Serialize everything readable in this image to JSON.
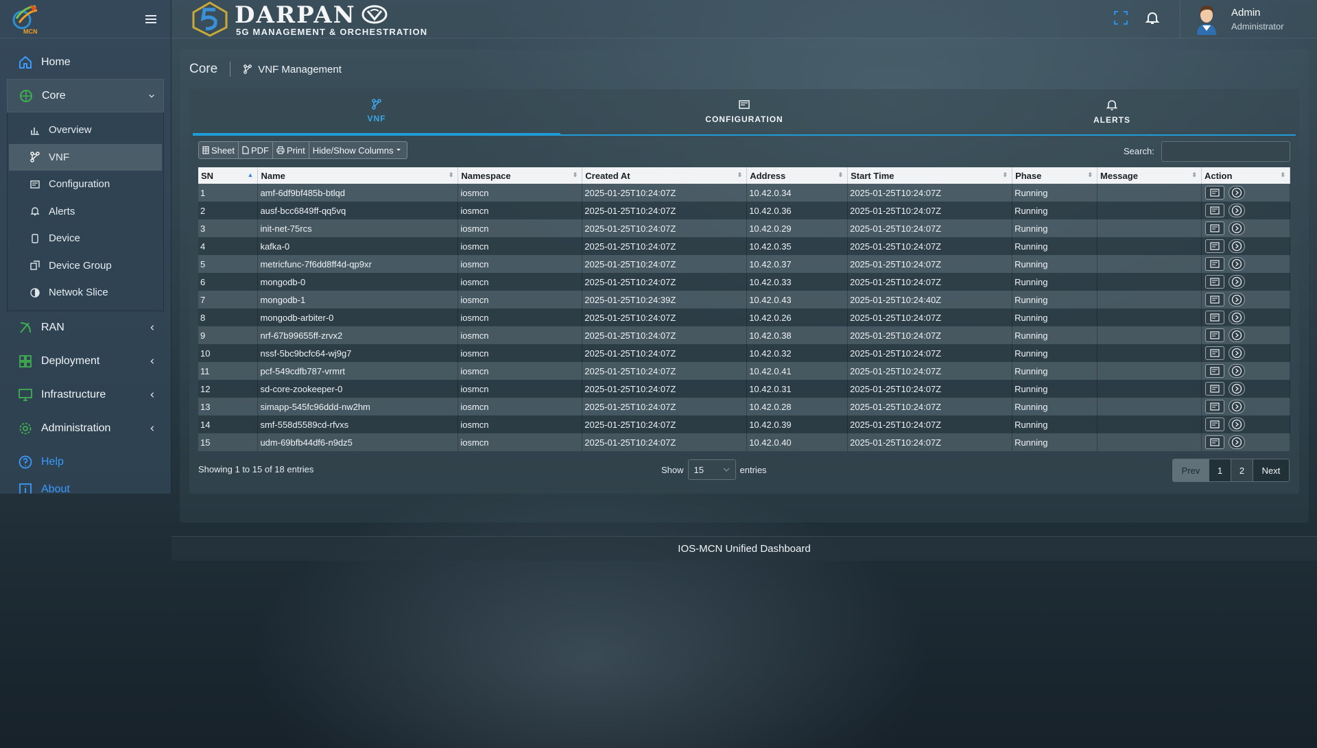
{
  "sidebar": {
    "brand_mark": "MCN",
    "items": [
      {
        "label": "Home",
        "icon": "home-icon"
      },
      {
        "label": "Core",
        "icon": "core-icon",
        "expanded": true
      },
      {
        "label": "RAN",
        "icon": "ran-icon"
      },
      {
        "label": "Deployment",
        "icon": "grid-icon"
      },
      {
        "label": "Infrastructure",
        "icon": "monitor-icon"
      },
      {
        "label": "Administration",
        "icon": "gear-icon"
      },
      {
        "label": "Help",
        "icon": "help-icon"
      },
      {
        "label": "About",
        "icon": "info-icon"
      }
    ],
    "core_sub": [
      {
        "label": "Overview",
        "icon": "bar-chart-icon"
      },
      {
        "label": "VNF",
        "icon": "vnf-icon",
        "active": true
      },
      {
        "label": "Configuration",
        "icon": "config-icon"
      },
      {
        "label": "Alerts",
        "icon": "bell-icon"
      },
      {
        "label": "Device",
        "icon": "phone-icon"
      },
      {
        "label": "Device Group",
        "icon": "device-group-icon"
      },
      {
        "label": "Netwok Slice",
        "icon": "slice-icon"
      }
    ]
  },
  "header": {
    "logo_title": "DARPAN",
    "logo_subtitle": "5G MANAGEMENT & ORCHESTRATION",
    "user_name": "Admin",
    "user_role": "Administrator"
  },
  "breadcrumb": {
    "root": "Core",
    "current": "VNF Management"
  },
  "tabs": [
    {
      "label": "VNF",
      "icon": "vnf-icon",
      "active": true
    },
    {
      "label": "CONFIGURATION",
      "icon": "config-icon"
    },
    {
      "label": "ALERTS",
      "icon": "bell-icon"
    }
  ],
  "toolbar": {
    "sheet": "Sheet",
    "pdf": "PDF",
    "print": "Print",
    "columns": "Hide/Show Columns"
  },
  "search": {
    "label": "Search:",
    "value": ""
  },
  "table": {
    "columns": [
      "SN",
      "Name",
      "Namespace",
      "Created At",
      "Address",
      "Start Time",
      "Phase",
      "Message",
      "Action"
    ],
    "rows": [
      [
        "1",
        "amf-6df9bf485b-btlqd",
        "iosmcn",
        "2025-01-25T10:24:07Z",
        "10.42.0.34",
        "2025-01-25T10:24:07Z",
        "Running",
        ""
      ],
      [
        "2",
        "ausf-bcc6849ff-qq5vq",
        "iosmcn",
        "2025-01-25T10:24:07Z",
        "10.42.0.36",
        "2025-01-25T10:24:07Z",
        "Running",
        ""
      ],
      [
        "3",
        "init-net-75rcs",
        "iosmcn",
        "2025-01-25T10:24:07Z",
        "10.42.0.29",
        "2025-01-25T10:24:07Z",
        "Running",
        ""
      ],
      [
        "4",
        "kafka-0",
        "iosmcn",
        "2025-01-25T10:24:07Z",
        "10.42.0.35",
        "2025-01-25T10:24:07Z",
        "Running",
        ""
      ],
      [
        "5",
        "metricfunc-7f6dd8ff4d-qp9xr",
        "iosmcn",
        "2025-01-25T10:24:07Z",
        "10.42.0.37",
        "2025-01-25T10:24:07Z",
        "Running",
        ""
      ],
      [
        "6",
        "mongodb-0",
        "iosmcn",
        "2025-01-25T10:24:07Z",
        "10.42.0.33",
        "2025-01-25T10:24:07Z",
        "Running",
        ""
      ],
      [
        "7",
        "mongodb-1",
        "iosmcn",
        "2025-01-25T10:24:39Z",
        "10.42.0.43",
        "2025-01-25T10:24:40Z",
        "Running",
        ""
      ],
      [
        "8",
        "mongodb-arbiter-0",
        "iosmcn",
        "2025-01-25T10:24:07Z",
        "10.42.0.26",
        "2025-01-25T10:24:07Z",
        "Running",
        ""
      ],
      [
        "9",
        "nrf-67b99655ff-zrvx2",
        "iosmcn",
        "2025-01-25T10:24:07Z",
        "10.42.0.38",
        "2025-01-25T10:24:07Z",
        "Running",
        ""
      ],
      [
        "10",
        "nssf-5bc9bcfc64-wj9g7",
        "iosmcn",
        "2025-01-25T10:24:07Z",
        "10.42.0.32",
        "2025-01-25T10:24:07Z",
        "Running",
        ""
      ],
      [
        "11",
        "pcf-549cdfb787-vrmrt",
        "iosmcn",
        "2025-01-25T10:24:07Z",
        "10.42.0.41",
        "2025-01-25T10:24:07Z",
        "Running",
        ""
      ],
      [
        "12",
        "sd-core-zookeeper-0",
        "iosmcn",
        "2025-01-25T10:24:07Z",
        "10.42.0.31",
        "2025-01-25T10:24:07Z",
        "Running",
        ""
      ],
      [
        "13",
        "simapp-545fc96ddd-nw2hm",
        "iosmcn",
        "2025-01-25T10:24:07Z",
        "10.42.0.28",
        "2025-01-25T10:24:07Z",
        "Running",
        ""
      ],
      [
        "14",
        "smf-558d5589cd-rfvxs",
        "iosmcn",
        "2025-01-25T10:24:07Z",
        "10.42.0.39",
        "2025-01-25T10:24:07Z",
        "Running",
        ""
      ],
      [
        "15",
        "udm-69bfb44df6-n9dz5",
        "iosmcn",
        "2025-01-25T10:24:07Z",
        "10.42.0.40",
        "2025-01-25T10:24:07Z",
        "Running",
        ""
      ]
    ],
    "action_icons": [
      "terminal-icon",
      "play-circle-icon"
    ]
  },
  "footer_table": {
    "info": "Showing 1 to 15 of 18 entries",
    "show_label": "Show",
    "page_length": "15",
    "entries_label": "entries",
    "pagination": {
      "prev": "Prev",
      "pages": [
        "1",
        "2"
      ],
      "next": "Next",
      "current": "1"
    }
  },
  "footer": "IOS-MCN Unified Dashboard",
  "colors": {
    "accent": "#1f9bd6",
    "link": "#3b9bff",
    "sidebar_bg": "#34485a"
  }
}
